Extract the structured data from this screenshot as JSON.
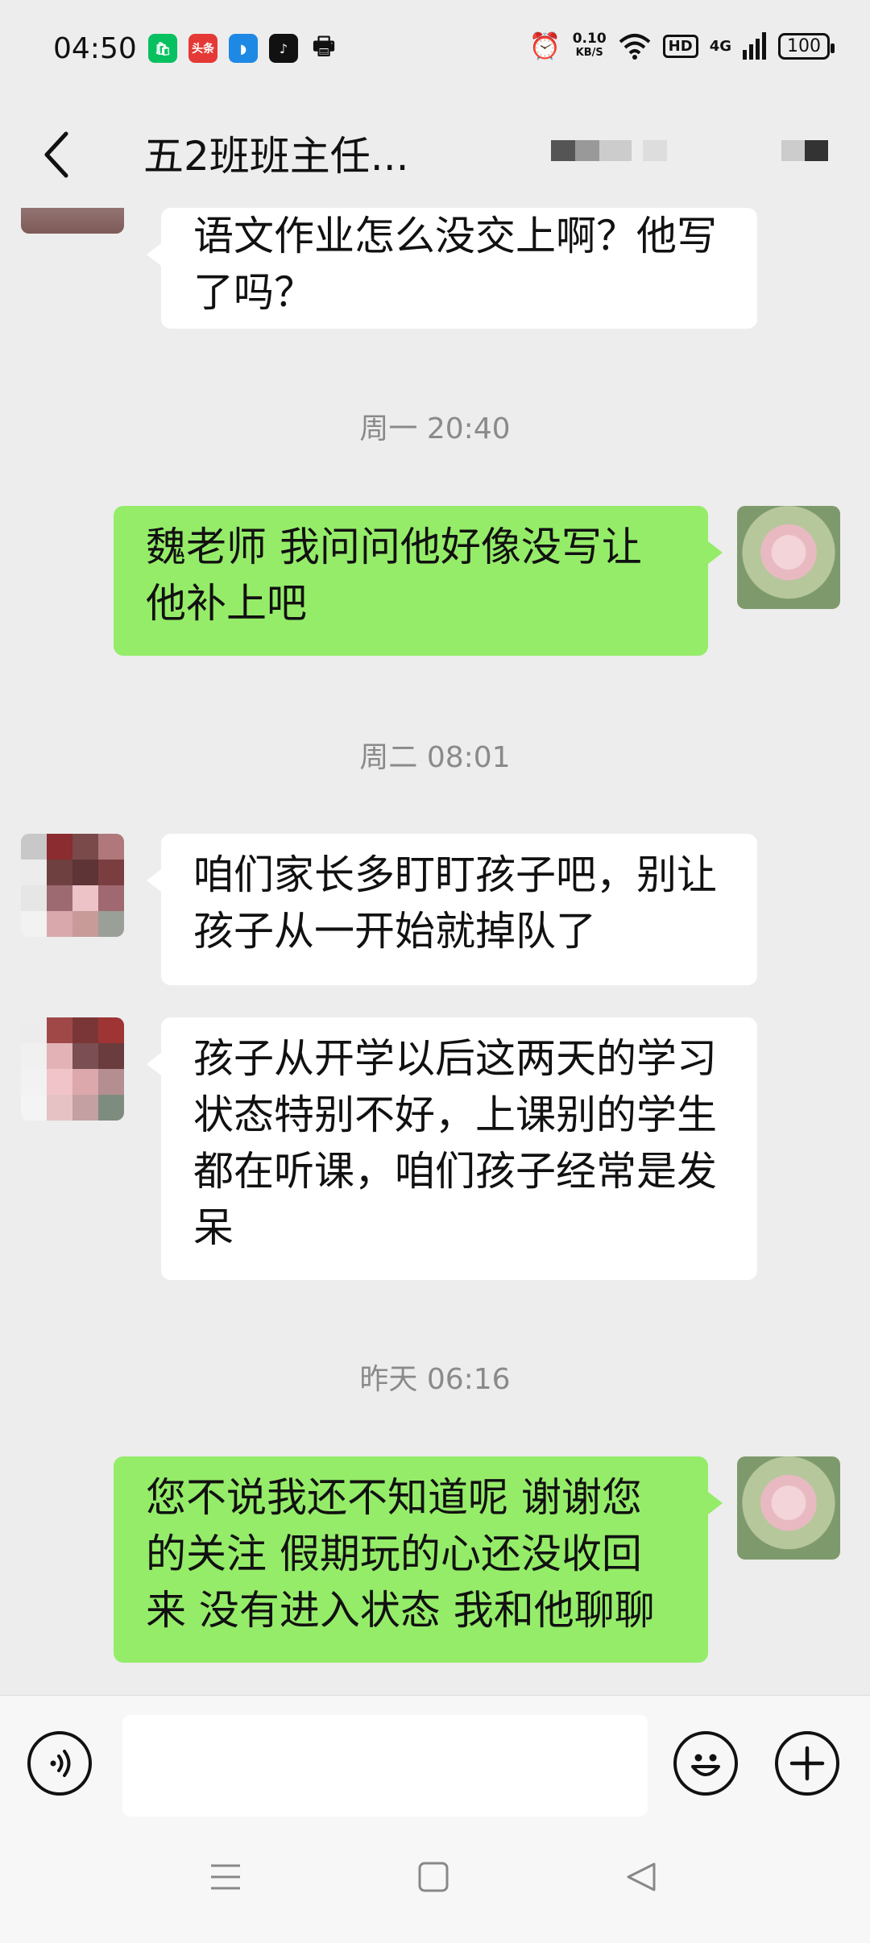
{
  "status_bar": {
    "time": "04:50",
    "app_icons": [
      {
        "name": "wechat-shop-app-icon",
        "color": "#07c160",
        "glyph": "🛍"
      },
      {
        "name": "toutiao-app-icon",
        "color": "#e53935",
        "glyph": "头条"
      },
      {
        "name": "blue-app-icon",
        "color": "#1e88e5",
        "glyph": "◗"
      },
      {
        "name": "douyin-app-icon",
        "color": "#111111",
        "glyph": "♪"
      },
      {
        "name": "printer-icon",
        "color": "#f7f7f7",
        "glyph": "🖶"
      }
    ],
    "net_speed": "0.10",
    "net_unit": "KB/S",
    "hd_label": "HD",
    "signal_label": "4G",
    "battery": "100"
  },
  "header": {
    "title": "五2班班主任..."
  },
  "chat": {
    "messages": [
      {
        "type": "in",
        "text": "语文作业怎么没交上啊？他写了吗？"
      },
      {
        "type": "time",
        "text": "周一 20:40"
      },
      {
        "type": "out",
        "text": "魏老师  我问问他好像没写让他补上吧"
      },
      {
        "type": "time",
        "text": "周二 08:01"
      },
      {
        "type": "in",
        "text": "咱们家长多盯盯孩子吧，别让孩子从一开始就掉队了"
      },
      {
        "type": "in",
        "text": "孩子从开学以后这两天的学习状态特别不好，上课别的学生都在听课，咱们孩子经常是发呆"
      },
      {
        "type": "time",
        "text": "昨天 06:16"
      },
      {
        "type": "out",
        "text": "您不说我还不知道呢  谢谢您的关注 假期玩的心还没收回来  没有进入状态 我和他聊聊"
      }
    ]
  },
  "input_bar": {
    "placeholder": ""
  },
  "colors": {
    "background": "#ededed",
    "outgoing_bubble": "#95ec69",
    "incoming_bubble": "#ffffff",
    "timestamp": "#8a8a8a"
  }
}
